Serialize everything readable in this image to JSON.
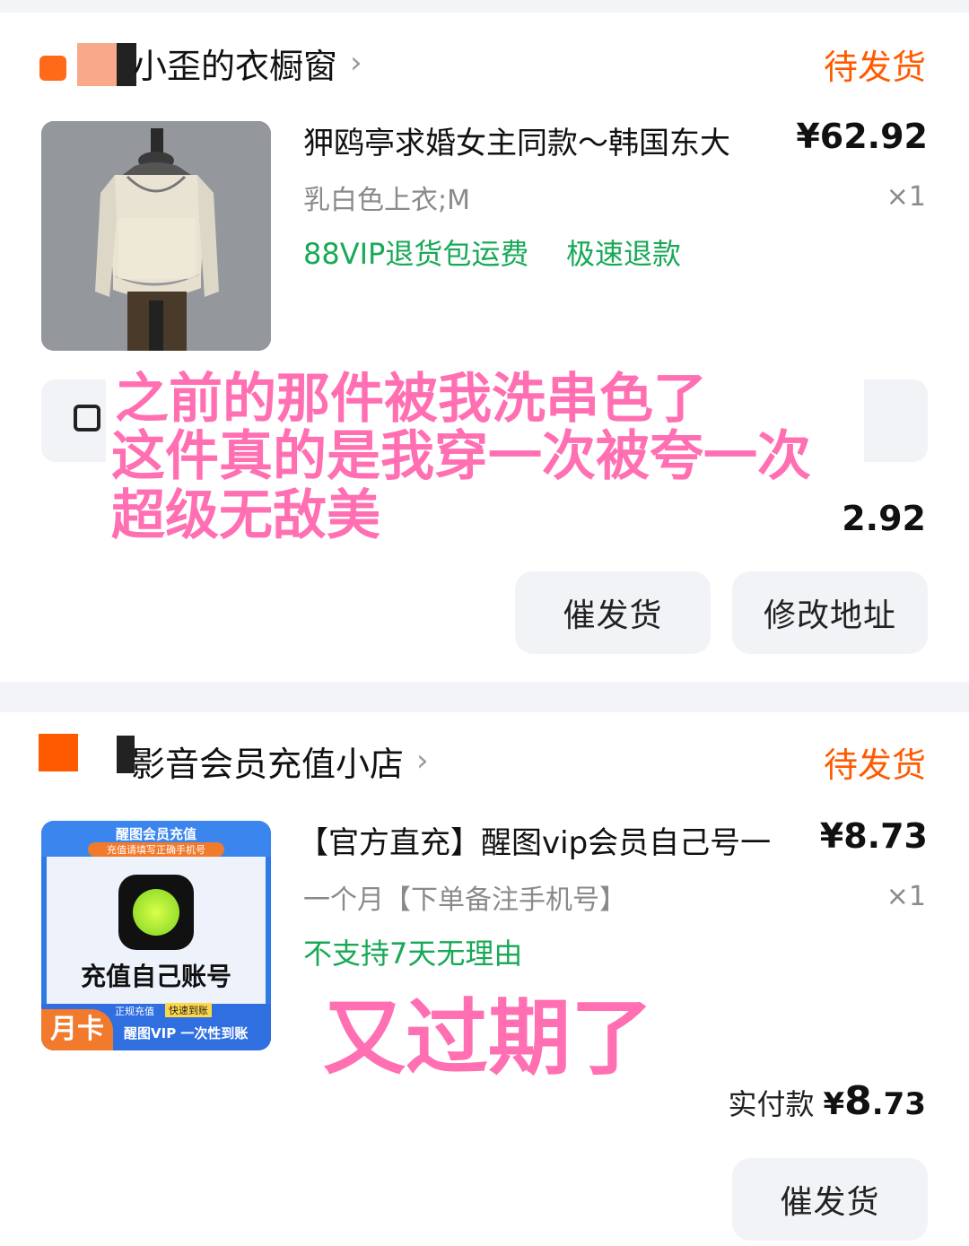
{
  "orders": [
    {
      "shop_name": "小歪的衣橱窗",
      "chevron": "›",
      "status": "待发货",
      "item_title": "狎鸥亭求婚女主同款～韩国东大",
      "item_price": "¥62.92",
      "item_spec": "乳白色上衣;M",
      "item_qty": "×1",
      "services": [
        "88VIP退货包运费",
        "极速退款"
      ],
      "total_partial": "2.92",
      "buttons": [
        "催发货",
        "修改地址"
      ]
    },
    {
      "shop_name": "影音会员充值小店",
      "chevron": "›",
      "status": "待发货",
      "item_title": "【官方直充】醒图vip会员自己号一",
      "item_price": "¥8.73",
      "item_spec": "一个月【下单备注手机号】",
      "item_qty": "×1",
      "services": [
        "不支持7天无理由"
      ],
      "paid_label": "实付款",
      "paid_symbol": "¥",
      "paid_int": "8",
      "paid_dec": ".73",
      "buttons": [
        "催发货"
      ],
      "product_image_text": {
        "top": "醒图会员充值",
        "sub": "充值请填写正确手机号",
        "main": "充值自己账号",
        "tag1": "正规充值",
        "tag2": "快速到账",
        "badge": "月卡",
        "bottom": "醒图VIP 一次性到账"
      }
    }
  ],
  "overlay_text": {
    "line1": "之前的那件被我洗串色了",
    "line2": "这件真的是我穿一次被夸一次",
    "line3": "超级无敌美",
    "line4": "又过期了"
  },
  "colors": {
    "status_orange": "#ff5a00",
    "service_green": "#18a957",
    "overlay_pink": "#ff6fb2",
    "shop_square": "#ff5a00"
  }
}
